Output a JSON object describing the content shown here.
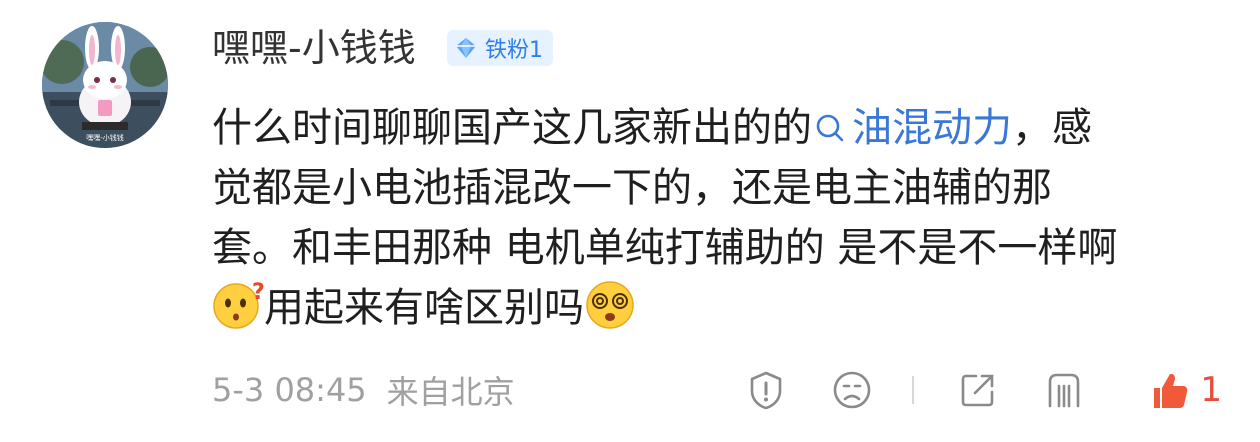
{
  "user": {
    "name": "嘿嘿-小钱钱",
    "badge": "铁粉1",
    "avatar_icon": "rabbit-avatar"
  },
  "comment": {
    "line1_before": "什么时间聊聊国产这几家新出的的",
    "topic": "油混动力",
    "line1_after": "，感",
    "line2": "觉都是小电池插混改一下的，还是电主油辅的那",
    "line3": "套。和丰田那种 电机单纯打辅助的 是不是不一样啊",
    "line4_text": "用起来有啥区别吗",
    "emoji1": "confused-emoji",
    "emoji2": "dizzy-emoji"
  },
  "meta": {
    "time": "5-3 08:45",
    "location": "来自北京"
  },
  "actions": {
    "like_count": "1",
    "icons": [
      "report-icon",
      "dislike-icon",
      "share-icon",
      "comment-list-icon",
      "like-icon"
    ]
  },
  "colors": {
    "topic": "#3a78d6",
    "badge_bg": "#e6f2ff",
    "badge_text": "#2f7fe8",
    "like": "#e74c3c",
    "meta": "#a0a0a0"
  }
}
